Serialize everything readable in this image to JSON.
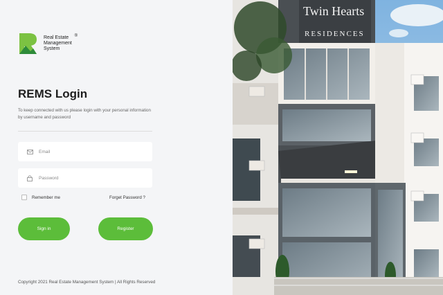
{
  "brand": {
    "line1": "Real Estate",
    "line2": "Management",
    "line3": "System",
    "registered": "®",
    "logo_icon": "rems-logo-icon",
    "accent_color": "#5cbd3a"
  },
  "login": {
    "title": "REMS Login",
    "subtitle": "To keep connected with us please login with your personal information by username and password"
  },
  "form": {
    "email_placeholder": "Email",
    "email_value": "",
    "email_icon": "envelope-icon",
    "password_placeholder": "Password",
    "password_value": "",
    "password_icon": "lock-icon",
    "remember_label": "Remember me",
    "forgot_label": "Forget Password ?",
    "signin_label": "Sign in",
    "register_label": "Register"
  },
  "hero": {
    "sign_line1": "Twin Hearts",
    "sign_line2": "RESIDENCES"
  },
  "footer": {
    "copyright": "Copyright 2021 Real Estate Management System | All Rights Reserved"
  }
}
